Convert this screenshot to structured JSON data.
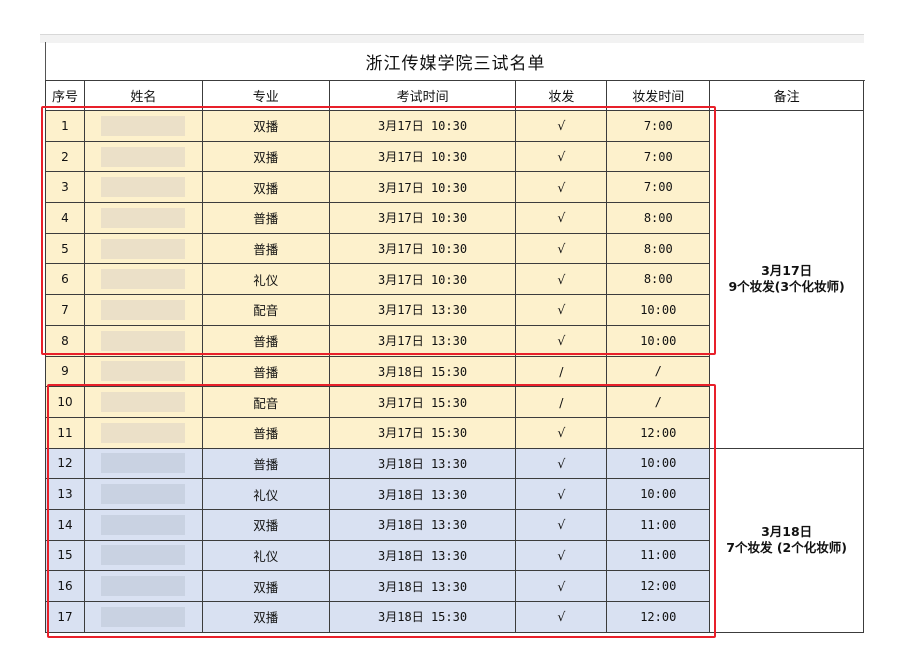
{
  "title": "浙江传媒学院三试名单",
  "columns": [
    "序号",
    "姓名",
    "专业",
    "考试时间",
    "妆发",
    "妆发时间",
    "备注"
  ],
  "rows": [
    {
      "no": "1",
      "major": "双播",
      "time": "3月17日 10:30",
      "makeup": "√",
      "makeup_time": "7:00"
    },
    {
      "no": "2",
      "major": "双播",
      "time": "3月17日 10:30",
      "makeup": "√",
      "makeup_time": "7:00"
    },
    {
      "no": "3",
      "major": "双播",
      "time": "3月17日 10:30",
      "makeup": "√",
      "makeup_time": "7:00"
    },
    {
      "no": "4",
      "major": "普播",
      "time": "3月17日 10:30",
      "makeup": "√",
      "makeup_time": "8:00"
    },
    {
      "no": "5",
      "major": "普播",
      "time": "3月17日 10:30",
      "makeup": "√",
      "makeup_time": "8:00"
    },
    {
      "no": "6",
      "major": "礼仪",
      "time": "3月17日 10:30",
      "makeup": "√",
      "makeup_time": "8:00"
    },
    {
      "no": "7",
      "major": "配音",
      "time": "3月17日 13:30",
      "makeup": "√",
      "makeup_time": "10:00"
    },
    {
      "no": "8",
      "major": "普播",
      "time": "3月17日 13:30",
      "makeup": "√",
      "makeup_time": "10:00"
    },
    {
      "no": "9",
      "major": "普播",
      "time": "3月18日 15:30",
      "makeup": "/",
      "makeup_time": "/"
    },
    {
      "no": "10",
      "major": "配音",
      "time": "3月17日 15:30",
      "makeup": "/",
      "makeup_time": "/"
    },
    {
      "no": "11",
      "major": "普播",
      "time": "3月17日 15:30",
      "makeup": "√",
      "makeup_time": "12:00"
    },
    {
      "no": "12",
      "major": "普播",
      "time": "3月18日 13:30",
      "makeup": "√",
      "makeup_time": "10:00"
    },
    {
      "no": "13",
      "major": "礼仪",
      "time": "3月18日 13:30",
      "makeup": "√",
      "makeup_time": "10:00"
    },
    {
      "no": "14",
      "major": "双播",
      "time": "3月18日 13:30",
      "makeup": "√",
      "makeup_time": "11:00"
    },
    {
      "no": "15",
      "major": "礼仪",
      "time": "3月18日 13:30",
      "makeup": "√",
      "makeup_time": "11:00"
    },
    {
      "no": "16",
      "major": "双播",
      "time": "3月18日 13:30",
      "makeup": "√",
      "makeup_time": "12:00"
    },
    {
      "no": "17",
      "major": "双播",
      "time": "3月18日 15:30",
      "makeup": "√",
      "makeup_time": "12:00"
    }
  ],
  "notes": {
    "group1_line1": "3月17日",
    "group1_line2": "9个妆发(3个化妆师)",
    "group2_line1": "3月18日",
    "group2_line2": "7个妆发 (2个化妆师)"
  },
  "colors": {
    "row_yellow": "#fdf1cc",
    "row_blue": "#d9e1f2",
    "highlight_red": "#e8202a"
  }
}
